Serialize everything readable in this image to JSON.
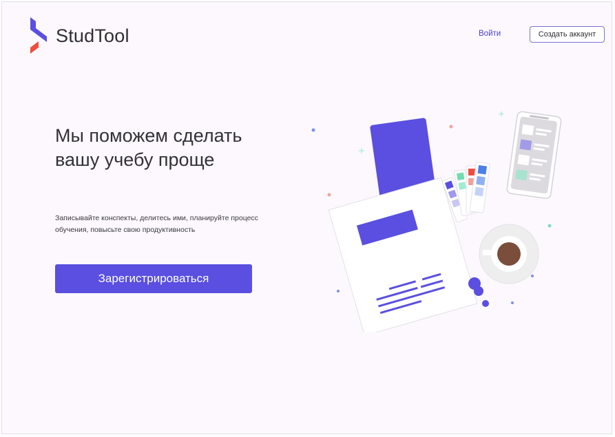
{
  "header": {
    "logo_text": "StudTool",
    "login_label": "Войти",
    "signup_label": "Создать аккаунт"
  },
  "hero": {
    "title": "Мы поможем сделать вашу учебу проще",
    "subtitle": "Записывайте конспекты, делитесь ими, планируйте процесс обучения, повысьте свою продуктивность",
    "cta_label": "Зарегистрироваться"
  },
  "colors": {
    "accent": "#5a4fe0",
    "logo_red": "#ee4d3f",
    "background": "#fcf8fd"
  },
  "icons": {
    "logo": "studtool-logo-icon",
    "illustration": "study-desk-illustration"
  }
}
